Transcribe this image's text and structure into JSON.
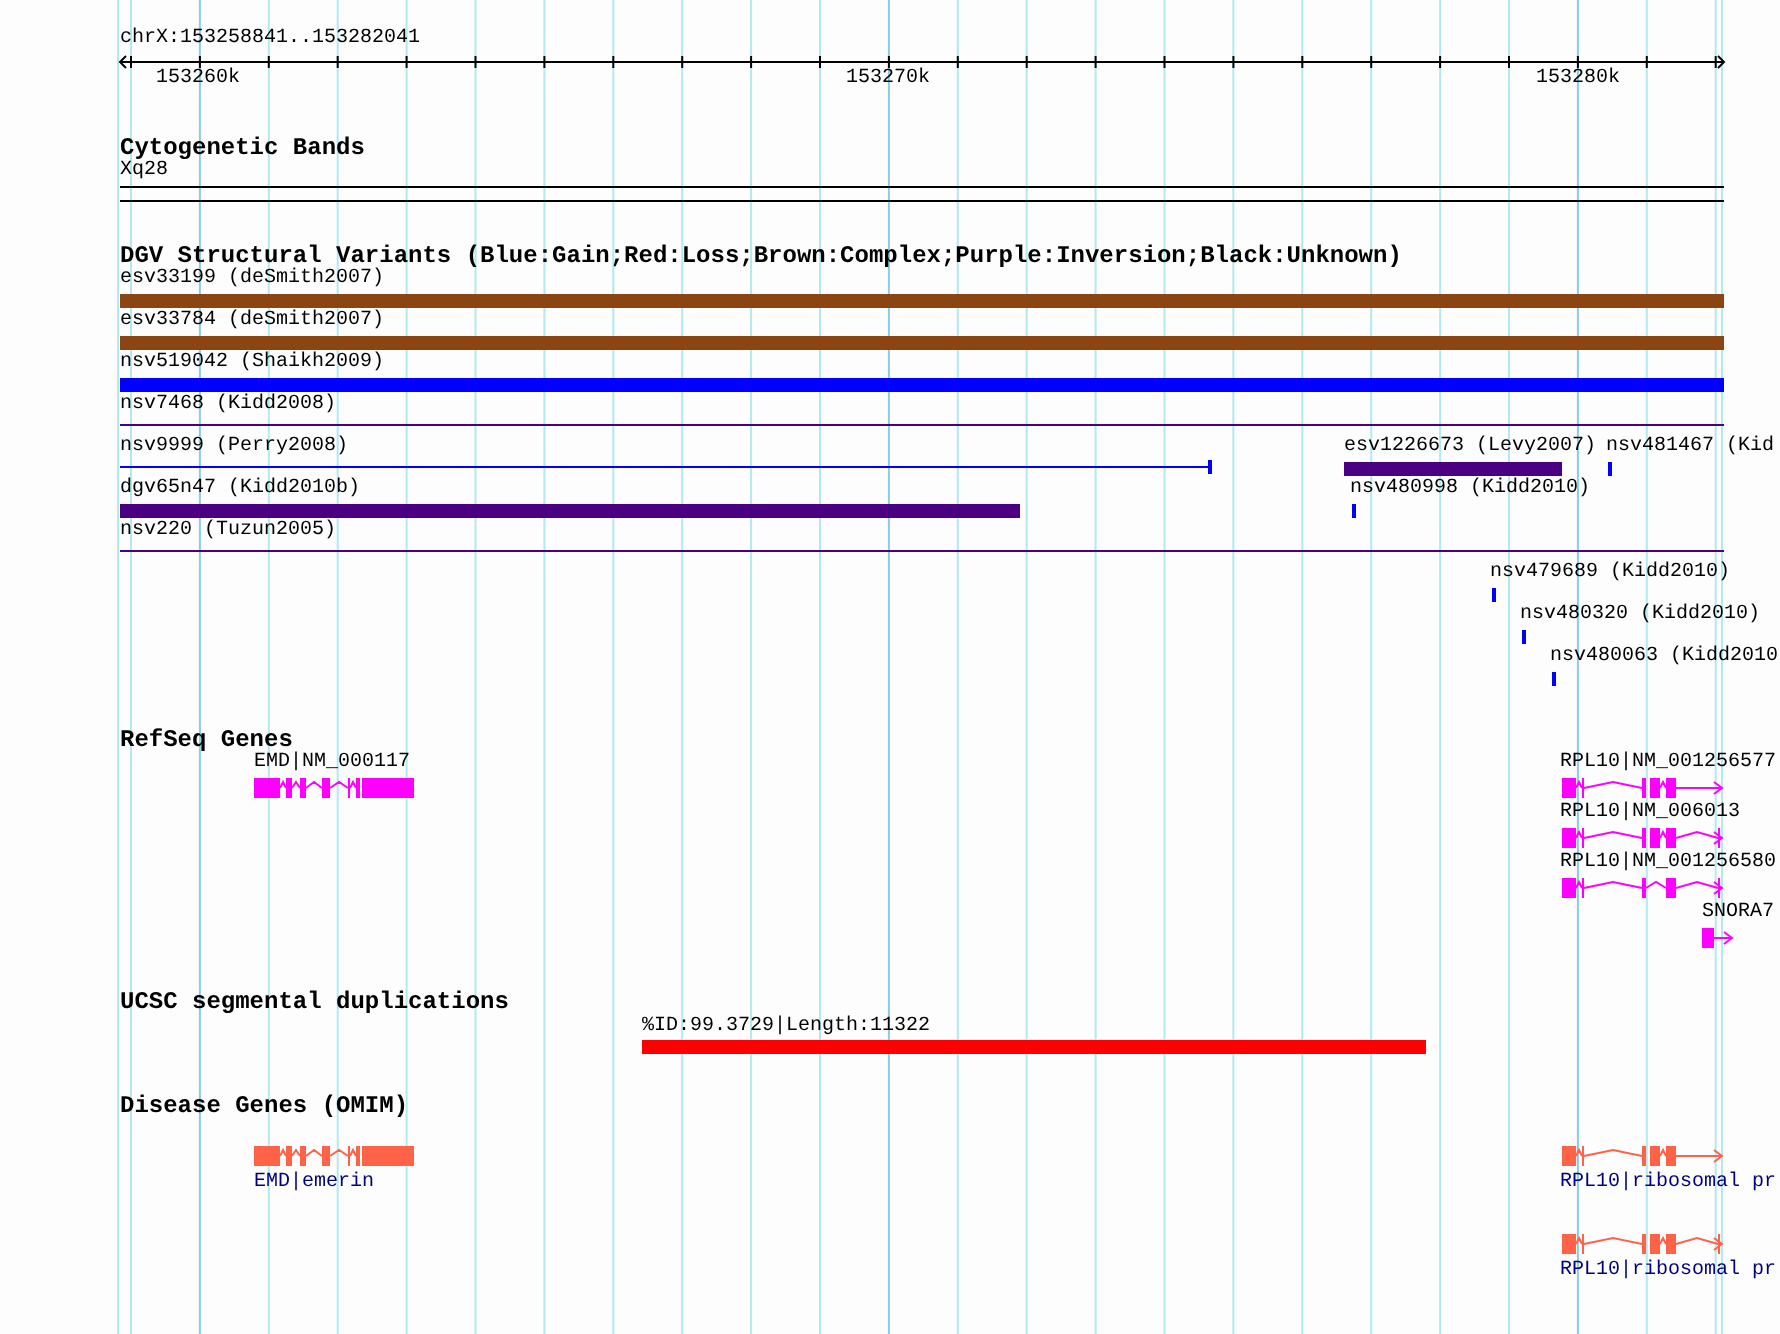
{
  "ruler": {
    "position": "chrX:153258841..153282041",
    "ticks": [
      "153260k",
      "153270k",
      "153280k"
    ]
  },
  "cytoband": {
    "title": "Cytogenetic Bands",
    "band": "Xq28"
  },
  "dgv": {
    "title": "DGV Structural Variants (Blue:Gain;Red:Loss;Brown:Complex;Purple:Inversion;Black:Unknown)",
    "features": [
      {
        "label": "esv33199 (deSmith2007)",
        "kind": "bar",
        "color": "#8b4513"
      },
      {
        "label": "esv33784 (deSmith2007)",
        "kind": "bar",
        "color": "#8b4513"
      },
      {
        "label": "nsv519042 (Shaikh2009)",
        "kind": "bar",
        "color": "#0000ff"
      },
      {
        "label": "nsv7468 (Kidd2008)",
        "kind": "line",
        "color": "#4b0082"
      },
      {
        "label": "nsv9999 (Perry2008)",
        "kind": "line",
        "color": "#0000ff"
      },
      {
        "label": "esv1226673 (Levy2007)",
        "kind": "bar",
        "color": "#4b0082"
      },
      {
        "label": "nsv481467 (Kid",
        "kind": "bar",
        "color": "#0000ff"
      },
      {
        "label": "dgv65n47 (Kidd2010b)",
        "kind": "bar",
        "color": "#4b0082"
      },
      {
        "label": "nsv480998 (Kidd2010)",
        "kind": "bar",
        "color": "#0000ff"
      },
      {
        "label": "nsv220 (Tuzun2005)",
        "kind": "line",
        "color": "#4b0082"
      },
      {
        "label": "nsv479689 (Kidd2010)",
        "kind": "bar",
        "color": "#0000ff"
      },
      {
        "label": "nsv480320 (Kidd2010)",
        "kind": "bar",
        "color": "#0000ff"
      },
      {
        "label": "nsv480063 (Kidd2010",
        "kind": "bar",
        "color": "#0000ff"
      }
    ]
  },
  "refseq": {
    "title": "RefSeq Genes",
    "genes": [
      {
        "label": "EMD|NM_000117"
      },
      {
        "label": "RPL10|NM_001256577"
      },
      {
        "label": "RPL10|NM_006013"
      },
      {
        "label": "RPL10|NM_001256580"
      },
      {
        "label": "SNORA7"
      }
    ]
  },
  "segdups": {
    "title": "UCSC segmental duplications",
    "features": [
      {
        "label": "%ID:99.3729|Length:11322"
      }
    ]
  },
  "omim": {
    "title": "Disease Genes (OMIM)",
    "genes": [
      {
        "label": "EMD|emerin"
      },
      {
        "label": "RPL10|ribosomal pr"
      },
      {
        "label": "RPL10|ribosomal pr"
      }
    ]
  }
}
